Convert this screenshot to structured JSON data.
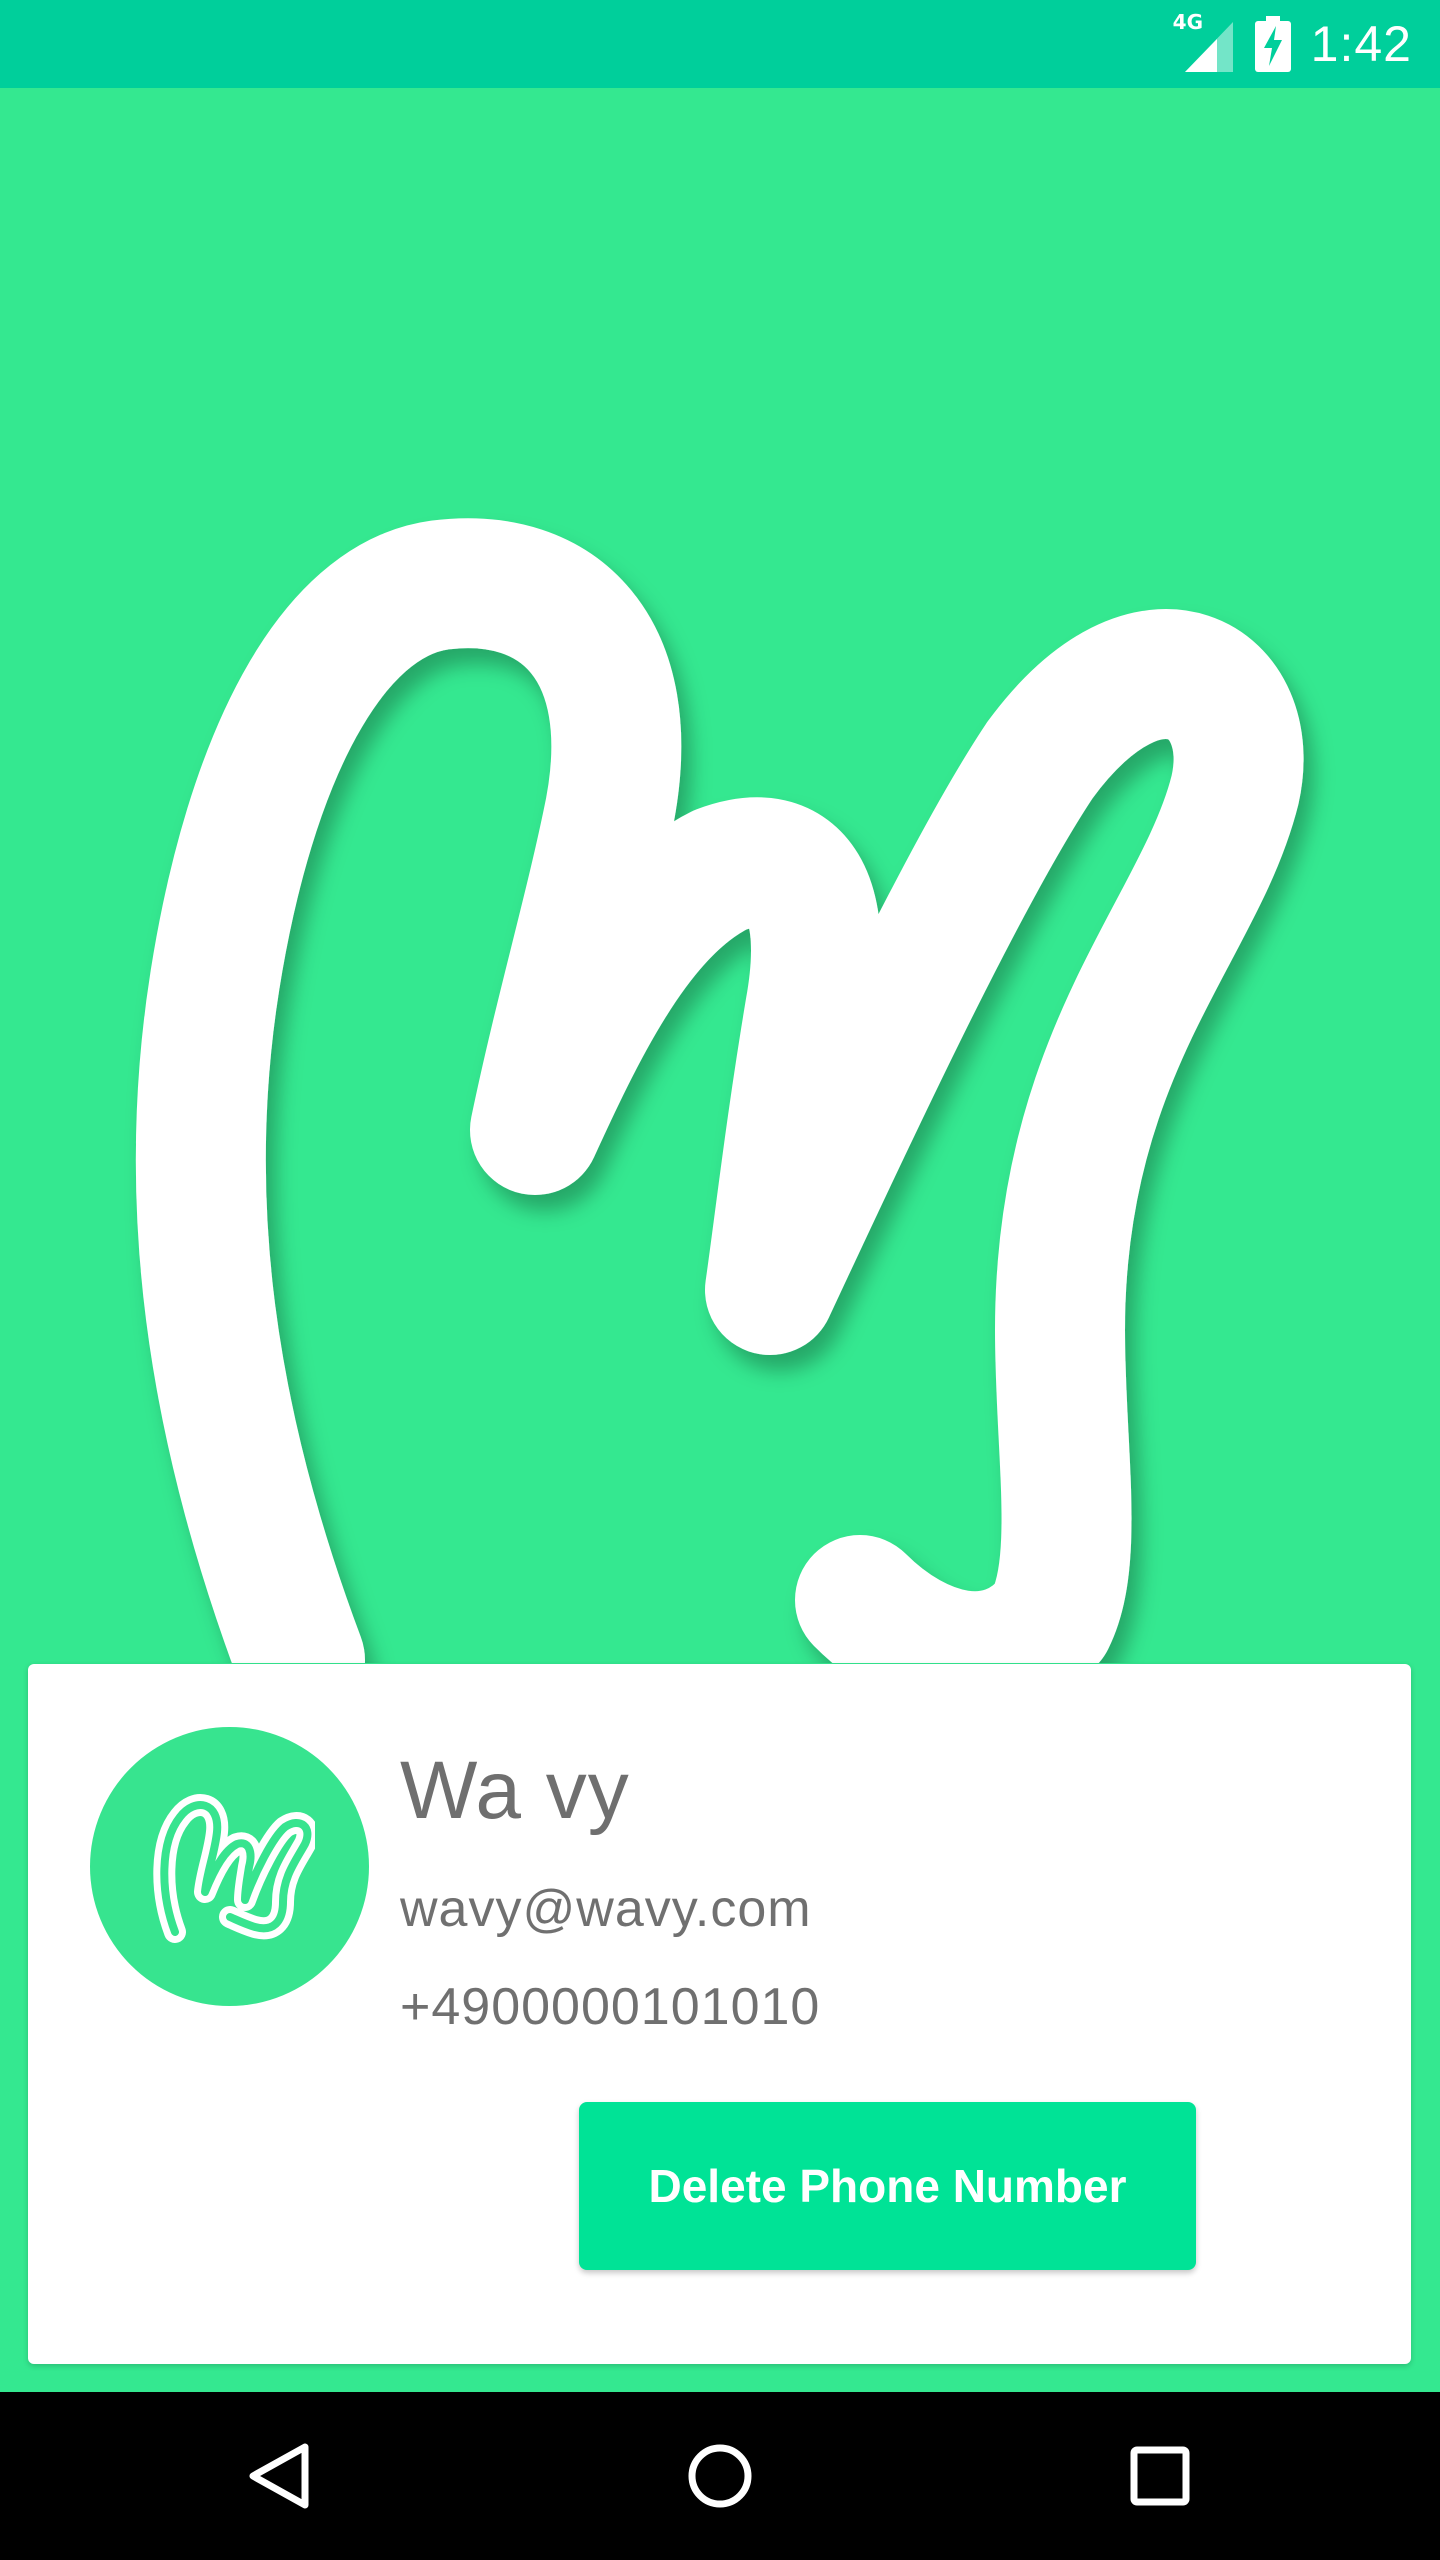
{
  "status_bar": {
    "network_label": "4G",
    "time": "1:42",
    "icons": [
      "signal-icon",
      "battery-charging-icon"
    ]
  },
  "hero": {
    "logo": "wavy-logo-large"
  },
  "profile_card": {
    "avatar_icon": "wavy-logo-icon",
    "name": "Wa vy",
    "email": "wavy@wavy.com",
    "phone": "+4900000101010",
    "delete_button_label": "Delete Phone Number"
  },
  "nav_bar": {
    "icons": [
      "back-icon",
      "home-icon",
      "recents-icon"
    ]
  },
  "colors": {
    "accent": "#34E890",
    "status_bar": "#00CF9B",
    "button": "#00E396",
    "text": "#6F6F6F"
  }
}
